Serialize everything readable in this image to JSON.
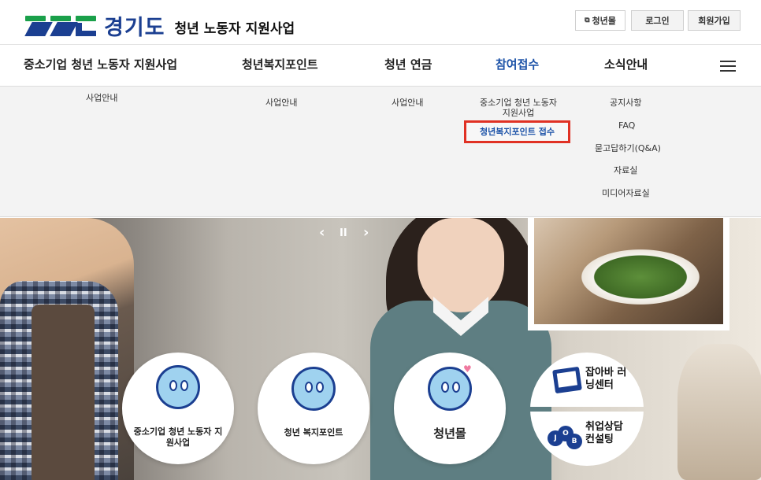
{
  "header": {
    "logo_text": "경기도",
    "logo_sub": "청년 노동자 지원사업",
    "util": {
      "mall": "청년몰",
      "login": "로그인",
      "join": "회원가입"
    }
  },
  "gnb": {
    "items": [
      "중소기업 청년 노동자 지원사업",
      "청년복지포인트",
      "청년 연금",
      "참여접수",
      "소식안내"
    ],
    "active": "참여접수"
  },
  "submenu": {
    "col1": [
      "사업안내"
    ],
    "col2": [
      "사업안내"
    ],
    "col3": [
      "사업안내"
    ],
    "col4": [
      "중소기업 청년 노동자 지원사업",
      "청년복지포인트 접수"
    ],
    "col5": [
      "공지사항",
      "FAQ",
      "묻고답하기(Q&A)",
      "자료실",
      "미디어자료실"
    ]
  },
  "slider": {
    "prev": "‹",
    "pause": "II",
    "next": "›"
  },
  "quick": {
    "c1": "중소기업 청년 노동자 지원사업",
    "c2": "청년 복지포인트",
    "c3": "청년몰",
    "c4a": "잡아바 러닝센터",
    "c4b": "취업상담 컨설팅",
    "job_badge": [
      "J",
      "O",
      "B"
    ]
  },
  "colors": {
    "brand_blue": "#1b3f91",
    "brand_green": "#1aa04a",
    "active": "#1d53a8",
    "highlight_border": "#e03124"
  },
  "icons": [
    "menu-icon",
    "external-link-icon",
    "mascot-icon",
    "notepad-icon",
    "job-badge-icon"
  ]
}
